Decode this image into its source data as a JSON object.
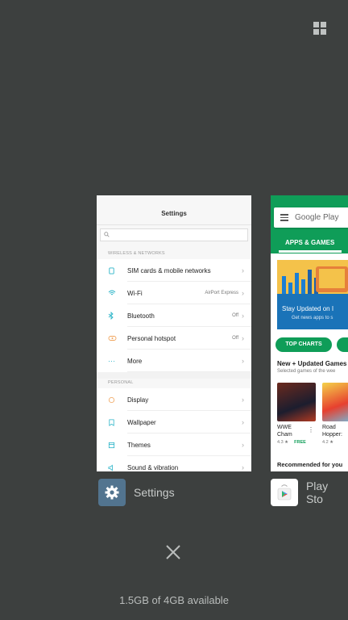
{
  "recents": {
    "memory_text": "1.5GB of 4GB available",
    "grid_icon": "grid-icon",
    "close_icon": "close-icon"
  },
  "settings_card": {
    "app_name": "Settings",
    "title": "Settings",
    "sections": [
      {
        "header": "WIRELESS & NETWORKS",
        "items": [
          {
            "label": "SIM cards & mobile networks",
            "value": "",
            "icon": "sim-icon"
          },
          {
            "label": "Wi-Fi",
            "value": "AirPort Express",
            "icon": "wifi-icon"
          },
          {
            "label": "Bluetooth",
            "value": "Off",
            "icon": "bluetooth-icon"
          },
          {
            "label": "Personal hotspot",
            "value": "Off",
            "icon": "hotspot-icon"
          },
          {
            "label": "More",
            "value": "",
            "icon": "more-icon"
          }
        ]
      },
      {
        "header": "PERSONAL",
        "items": [
          {
            "label": "Display",
            "value": "",
            "icon": "display-icon"
          },
          {
            "label": "Wallpaper",
            "value": "",
            "icon": "wallpaper-icon"
          },
          {
            "label": "Themes",
            "value": "",
            "icon": "themes-icon"
          },
          {
            "label": "Sound & vibration",
            "value": "",
            "icon": "sound-icon"
          }
        ]
      }
    ]
  },
  "play_card": {
    "app_name": "Play Sto",
    "search_text": "Google Play",
    "tab": "APPS & GAMES",
    "banner_title": "Stay Updated on I",
    "banner_sub": "Get news apps to s",
    "chip": "TOP CHARTS",
    "section_title": "New + Updated Games",
    "section_sub": "Selected games of the wee",
    "games": [
      {
        "name": "WWE Cham",
        "rating": "4.3 ★",
        "price": "FREE"
      },
      {
        "name": "Road Hopper:",
        "rating": "4.2 ★",
        "price": ""
      }
    ],
    "recommended": "Recommended for you",
    "colors": {
      "brand": "#0f9d58"
    }
  }
}
